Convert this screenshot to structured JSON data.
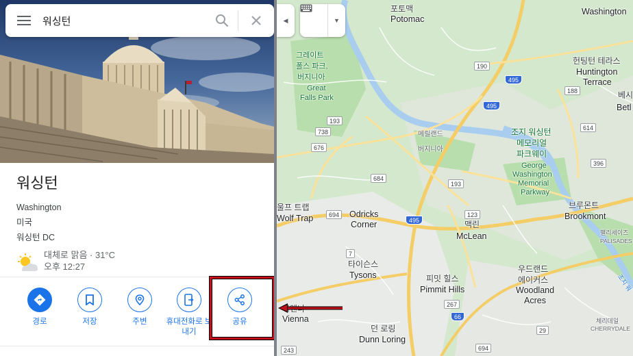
{
  "search": {
    "query": "워싱턴",
    "menu_icon": "hamburger-icon",
    "search_icon": "search-icon",
    "close_icon": "close-icon"
  },
  "place": {
    "title": "워싱턴",
    "name_en": "Washington",
    "country": "미국",
    "region": "워싱턴 DC",
    "weather": {
      "condition": "대체로 맑음 · 31°C",
      "time": "오후 12:27",
      "icon": "partly-sunny-icon"
    }
  },
  "actions": [
    {
      "label": "경로",
      "icon": "directions-icon"
    },
    {
      "label": "저장",
      "icon": "bookmark-icon"
    },
    {
      "label": "주변",
      "icon": "nearby-icon"
    },
    {
      "label": "휴대전화로 보",
      "label2": "내기",
      "icon": "send-to-phone-icon"
    },
    {
      "label": "공유",
      "icon": "share-icon"
    }
  ],
  "map_controls": {
    "collapse_icon": "collapse-arrow-icon",
    "keyboard_icon": "keyboard-icon",
    "dropdown_icon": "dropdown-arrow-icon"
  },
  "map_labels": {
    "potomac_ko": "포토맥",
    "potomac_en": "Potomac",
    "washington_en": "Washington",
    "great_falls_ko1": "그레이트",
    "great_falls_ko2": "폴스 파크,",
    "great_falls_ko3": "버지니아",
    "great_falls_en1": "Great",
    "great_falls_en2": "Falls Park",
    "huntington_ko": "헌팅턴 테라스",
    "huntington_en1": "Huntington",
    "huntington_en2": "Terrace",
    "bethesda_ko": "베시",
    "bethesda_en": "Betl",
    "maryland": "메릴랜드",
    "virginia": "버지니아",
    "gwmp_ko1": "조지 워싱턴",
    "gwmp_ko2": "메모리얼",
    "gwmp_ko3": "파크웨이",
    "gwmp_en1": "George",
    "gwmp_en2": "Washington",
    "gwmp_en3": "Memorial",
    "gwmp_en4": "Parkway",
    "wolf_trap_ko": "울프 트랩",
    "wolf_trap_en": "Wolf Trap",
    "odricks_en1": "Odricks",
    "odricks_en2": "Corner",
    "mclean_ko": "맥린",
    "mclean_en": "McLean",
    "brookmont_ko": "브루몬트",
    "brookmont_en": "Brookmont",
    "palisades_ko": "팰리세이즈",
    "palisades_en": "PALISADES",
    "tysons_ko": "타이슨스",
    "tysons_en": "Tysons",
    "pimmit_ko": "피밋 힐스",
    "pimmit_en": "Pimmit Hills",
    "woodland_ko1": "우드랜드",
    "woodland_ko2": "에이커스",
    "woodland_en1": "Woodland",
    "woodland_en2": "Acres",
    "vienna_ko": "비엔나",
    "vienna_en": "Vienna",
    "dunn_ko": "던 로링",
    "dunn_en": "Dunn Loring",
    "cherrydale_ko": "체리데일",
    "cherrydale_en": "CHERRYDALE",
    "chain_bridge": "조지 워"
  },
  "shields": [
    "495",
    "190",
    "495",
    "188",
    "614",
    "193",
    "738",
    "676",
    "193",
    "684",
    "396",
    "694",
    "495",
    "123",
    "7",
    "267",
    "66",
    "29",
    "243",
    "694"
  ],
  "colors": {
    "accent": "#1a73e8",
    "highlight": "#c1101a",
    "map_park": "#c8e6c0",
    "map_water": "#a8cdee",
    "road": "#f5cd66"
  }
}
